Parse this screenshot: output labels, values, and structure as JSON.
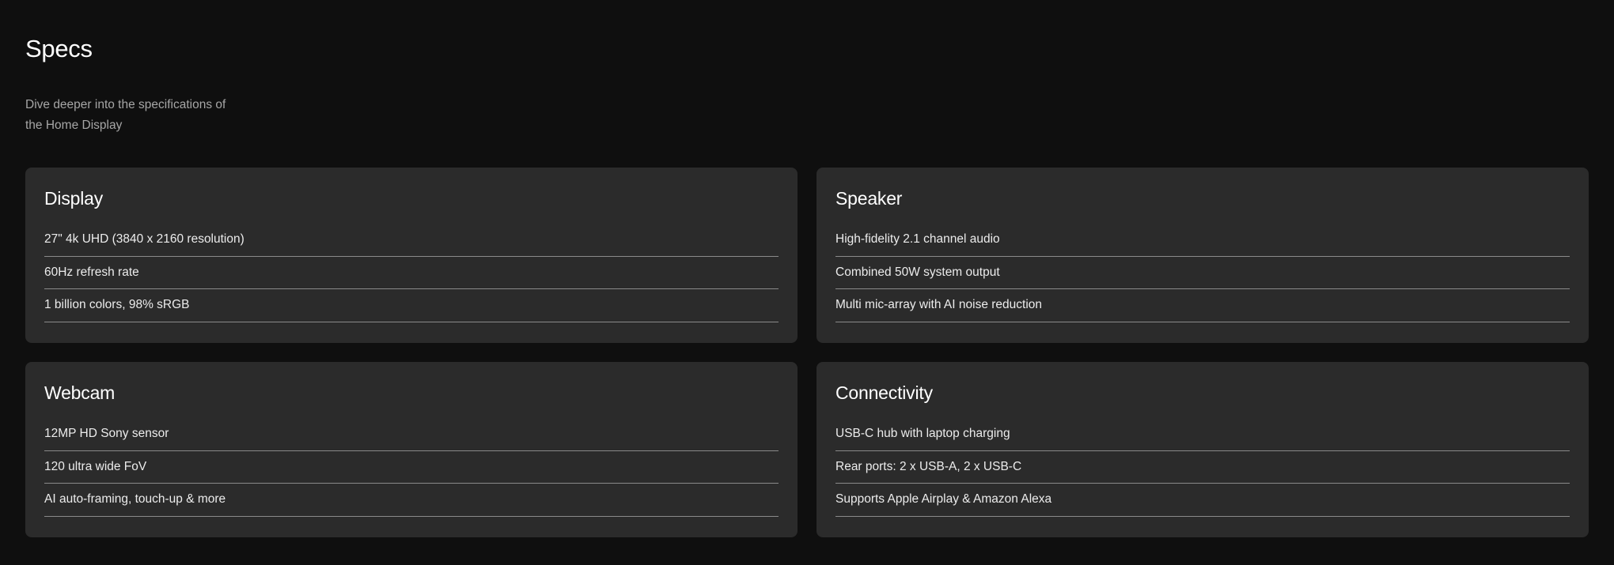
{
  "header": {
    "title": "Specs",
    "subtitle_line1": "Dive deeper into the specifications of",
    "subtitle_line2": "the Home Display"
  },
  "cards": [
    {
      "title": "Display",
      "items": [
        "27\" 4k UHD (3840 x 2160 resolution)",
        "60Hz refresh rate",
        "1 billion colors, 98% sRGB"
      ]
    },
    {
      "title": "Speaker",
      "items": [
        "High-fidelity 2.1 channel audio",
        "Combined 50W system output",
        "Multi mic-array with AI noise reduction"
      ]
    },
    {
      "title": "Webcam",
      "items": [
        "12MP HD Sony sensor",
        "120 ultra wide FoV",
        "AI auto-framing, touch-up & more"
      ]
    },
    {
      "title": "Connectivity",
      "items": [
        "USB-C hub with laptop charging",
        "Rear ports: 2 x USB-A, 2 x USB-C",
        "Supports Apple Airplay & Amazon Alexa"
      ]
    }
  ],
  "colors": {
    "background": "#0f0f0f",
    "card": "#2b2b2b",
    "divider": "#8a8a8a",
    "subtitle": "#a6a6a6"
  }
}
